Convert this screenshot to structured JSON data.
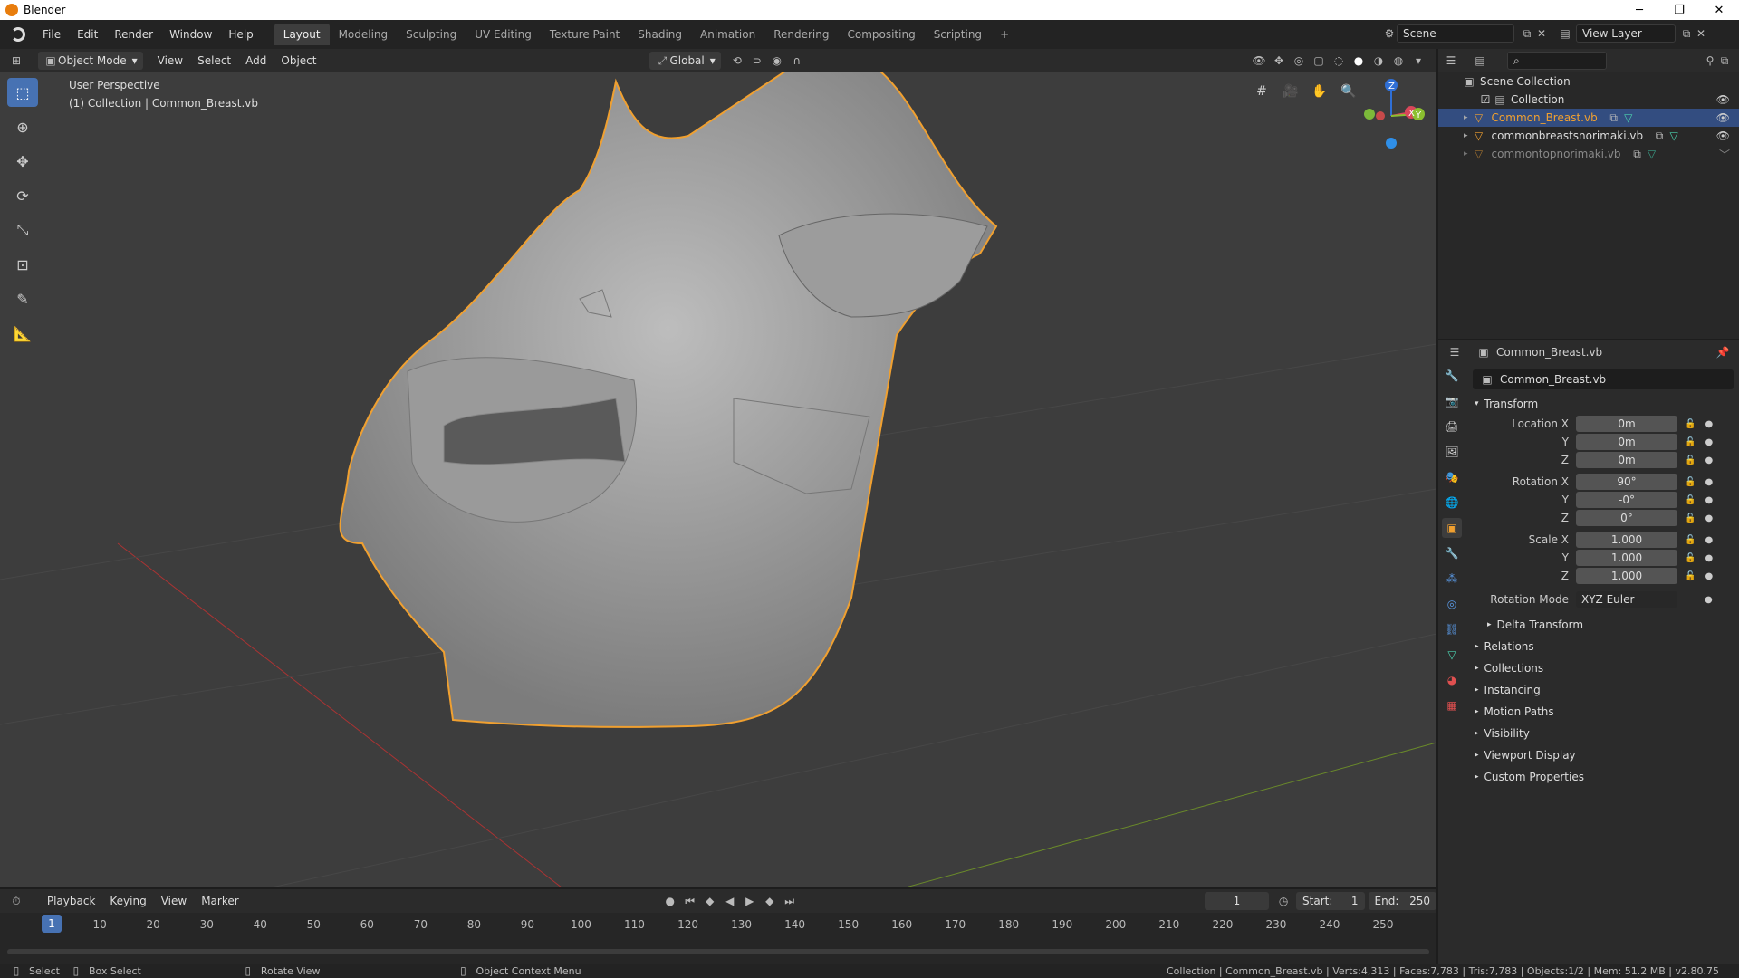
{
  "window": {
    "title": "Blender"
  },
  "menu": [
    "File",
    "Edit",
    "Render",
    "Window",
    "Help"
  ],
  "workspaces": [
    "Layout",
    "Modeling",
    "Sculpting",
    "UV Editing",
    "Texture Paint",
    "Shading",
    "Animation",
    "Rendering",
    "Compositing",
    "Scripting"
  ],
  "workspace_add": "+",
  "scene": {
    "name": "Scene",
    "view_layer": "View Layer"
  },
  "viewport": {
    "mode": "Object Mode",
    "menus": [
      "View",
      "Select",
      "Add",
      "Object"
    ],
    "orientation": "Global",
    "info_line1": "User Perspective",
    "info_line2": "(1) Collection | Common_Breast.vb",
    "gizmo": {
      "x": "X",
      "y": "Y",
      "z": "Z"
    }
  },
  "timeline": {
    "menus": [
      "Playback",
      "Keying",
      "View",
      "Marker"
    ],
    "current_frame": "1",
    "start_label": "Start:",
    "start": "1",
    "end_label": "End:",
    "end": "250",
    "ruler": [
      "1",
      "10",
      "20",
      "30",
      "40",
      "50",
      "60",
      "70",
      "80",
      "90",
      "100",
      "110",
      "120",
      "130",
      "140",
      "150",
      "160",
      "170",
      "180",
      "190",
      "200",
      "210",
      "220",
      "230",
      "240",
      "250"
    ]
  },
  "status": {
    "select": "Select",
    "box_select": "Box Select",
    "rotate": "Rotate View",
    "context": "Object Context Menu",
    "stats": "Collection | Common_Breast.vb | Verts:4,313 | Faces:7,783 | Tris:7,783 | Objects:1/2 | Mem: 51.2 MB | v2.80.75"
  },
  "outliner": {
    "root": "Scene Collection",
    "collection": "Collection",
    "items": [
      "Common_Breast.vb",
      "commonbreastsnorimaki.vb",
      "commontopnorimaki.vb"
    ]
  },
  "properties": {
    "object_name": "Common_Breast.vb",
    "data_name": "Common_Breast.vb",
    "transform_title": "Transform",
    "location": {
      "label": "Location X",
      "x": "0m",
      "y": "0m",
      "z": "0m"
    },
    "rotation": {
      "label": "Rotation X",
      "x": "90°",
      "y": "-0°",
      "z": "0°"
    },
    "scale": {
      "label": "Scale X",
      "x": "1.000",
      "y": "1.000",
      "z": "1.000"
    },
    "axis_y": "Y",
    "axis_z": "Z",
    "rotation_mode_label": "Rotation Mode",
    "rotation_mode": "XYZ Euler",
    "delta": "Delta Transform",
    "sections": [
      "Relations",
      "Collections",
      "Instancing",
      "Motion Paths",
      "Visibility",
      "Viewport Display",
      "Custom Properties"
    ]
  },
  "colors": {
    "accent": "#4772b3",
    "selection_outline": "#f0a030"
  }
}
